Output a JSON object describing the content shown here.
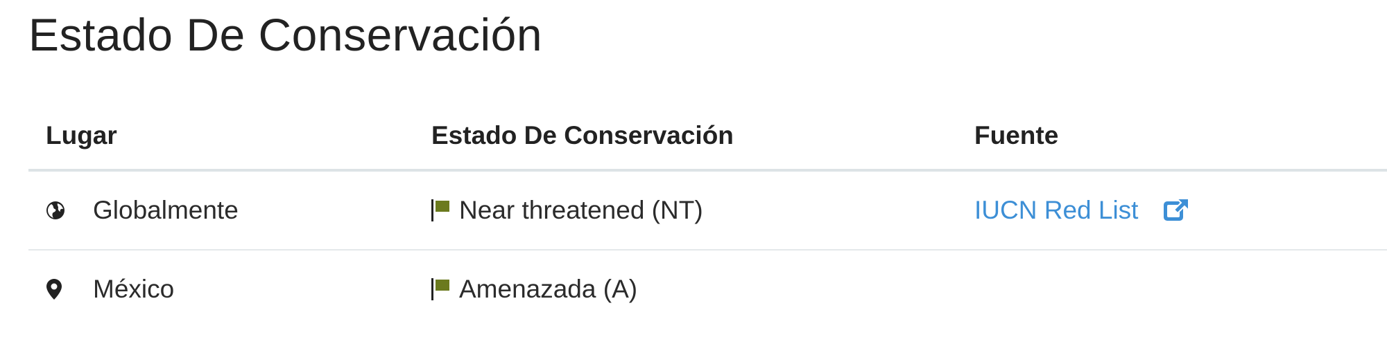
{
  "section": {
    "title": "Estado De Conservación"
  },
  "table": {
    "headers": {
      "place": "Lugar",
      "status": "Estado De Conservación",
      "source": "Fuente"
    },
    "rows": [
      {
        "place": "Globalmente",
        "place_icon": "globe-icon",
        "status": "Near threatened (NT)",
        "status_icon": "flag-icon",
        "status_color": "#6b7a1e",
        "source": "IUCN Red List",
        "source_icon": "external-link-icon"
      },
      {
        "place": "México",
        "place_icon": "map-marker-icon",
        "status": "Amenazada (A)",
        "status_icon": "flag-icon",
        "status_color": "#6b7a1e",
        "source": ""
      }
    ]
  },
  "colors": {
    "link": "#3d8fd6",
    "flag": "#6b7a1e",
    "divider": "#dde3e6"
  }
}
